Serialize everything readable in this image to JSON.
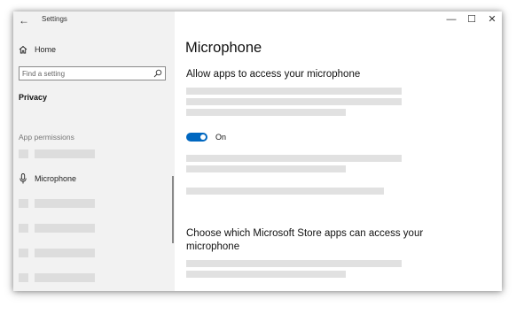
{
  "window": {
    "title": "Settings",
    "back_glyph": "←",
    "controls": {
      "minimize_glyph": "—",
      "maximize_glyph": "☐",
      "close_glyph": "✕"
    }
  },
  "sidebar": {
    "home_label": "Home",
    "home_icon": "home-icon",
    "search": {
      "placeholder": "Find a setting",
      "icon": "search-icon"
    },
    "category_label": "Privacy",
    "section_header": "App permissions",
    "items": [
      {
        "label": "",
        "placeholder": true
      },
      {
        "label": "Microphone",
        "icon": "microphone-icon",
        "selected": true
      },
      {
        "label": "",
        "placeholder": true
      },
      {
        "label": "",
        "placeholder": true
      },
      {
        "label": "",
        "placeholder": true
      },
      {
        "label": "",
        "placeholder": true
      }
    ]
  },
  "main": {
    "page_title": "Microphone",
    "allow_heading": "Allow apps to access your microphone",
    "toggle": {
      "state": "On",
      "on": true,
      "accent": "#0067c0"
    },
    "store_heading": "Choose which Microsoft Store apps can access your microphone"
  },
  "colors": {
    "sidebar_bg": "#f2f2f2",
    "placeholder_gray": "#e1e1e1",
    "accent": "#0067c0"
  }
}
